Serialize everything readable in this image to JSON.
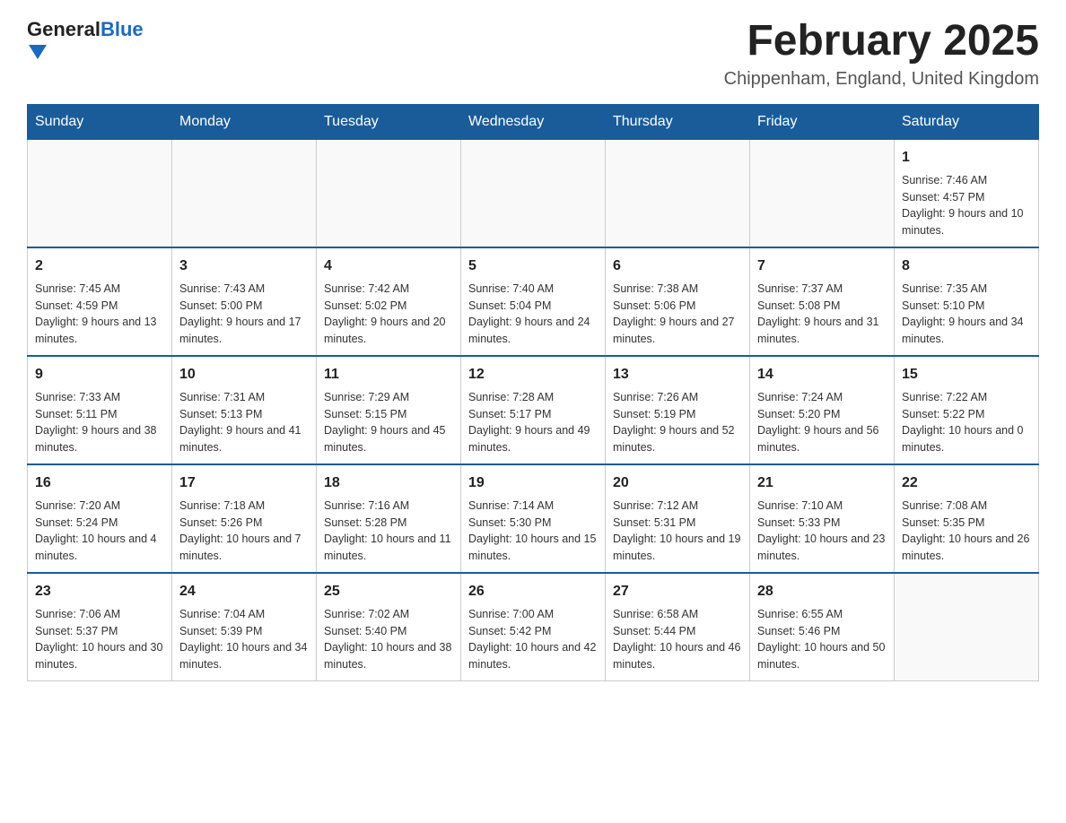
{
  "header": {
    "logo_general": "General",
    "logo_blue": "Blue",
    "title": "February 2025",
    "location": "Chippenham, England, United Kingdom"
  },
  "days_of_week": [
    "Sunday",
    "Monday",
    "Tuesday",
    "Wednesday",
    "Thursday",
    "Friday",
    "Saturday"
  ],
  "weeks": [
    [
      {
        "day": "",
        "info": ""
      },
      {
        "day": "",
        "info": ""
      },
      {
        "day": "",
        "info": ""
      },
      {
        "day": "",
        "info": ""
      },
      {
        "day": "",
        "info": ""
      },
      {
        "day": "",
        "info": ""
      },
      {
        "day": "1",
        "info": "Sunrise: 7:46 AM\nSunset: 4:57 PM\nDaylight: 9 hours and 10 minutes."
      }
    ],
    [
      {
        "day": "2",
        "info": "Sunrise: 7:45 AM\nSunset: 4:59 PM\nDaylight: 9 hours and 13 minutes."
      },
      {
        "day": "3",
        "info": "Sunrise: 7:43 AM\nSunset: 5:00 PM\nDaylight: 9 hours and 17 minutes."
      },
      {
        "day": "4",
        "info": "Sunrise: 7:42 AM\nSunset: 5:02 PM\nDaylight: 9 hours and 20 minutes."
      },
      {
        "day": "5",
        "info": "Sunrise: 7:40 AM\nSunset: 5:04 PM\nDaylight: 9 hours and 24 minutes."
      },
      {
        "day": "6",
        "info": "Sunrise: 7:38 AM\nSunset: 5:06 PM\nDaylight: 9 hours and 27 minutes."
      },
      {
        "day": "7",
        "info": "Sunrise: 7:37 AM\nSunset: 5:08 PM\nDaylight: 9 hours and 31 minutes."
      },
      {
        "day": "8",
        "info": "Sunrise: 7:35 AM\nSunset: 5:10 PM\nDaylight: 9 hours and 34 minutes."
      }
    ],
    [
      {
        "day": "9",
        "info": "Sunrise: 7:33 AM\nSunset: 5:11 PM\nDaylight: 9 hours and 38 minutes."
      },
      {
        "day": "10",
        "info": "Sunrise: 7:31 AM\nSunset: 5:13 PM\nDaylight: 9 hours and 41 minutes."
      },
      {
        "day": "11",
        "info": "Sunrise: 7:29 AM\nSunset: 5:15 PM\nDaylight: 9 hours and 45 minutes."
      },
      {
        "day": "12",
        "info": "Sunrise: 7:28 AM\nSunset: 5:17 PM\nDaylight: 9 hours and 49 minutes."
      },
      {
        "day": "13",
        "info": "Sunrise: 7:26 AM\nSunset: 5:19 PM\nDaylight: 9 hours and 52 minutes."
      },
      {
        "day": "14",
        "info": "Sunrise: 7:24 AM\nSunset: 5:20 PM\nDaylight: 9 hours and 56 minutes."
      },
      {
        "day": "15",
        "info": "Sunrise: 7:22 AM\nSunset: 5:22 PM\nDaylight: 10 hours and 0 minutes."
      }
    ],
    [
      {
        "day": "16",
        "info": "Sunrise: 7:20 AM\nSunset: 5:24 PM\nDaylight: 10 hours and 4 minutes."
      },
      {
        "day": "17",
        "info": "Sunrise: 7:18 AM\nSunset: 5:26 PM\nDaylight: 10 hours and 7 minutes."
      },
      {
        "day": "18",
        "info": "Sunrise: 7:16 AM\nSunset: 5:28 PM\nDaylight: 10 hours and 11 minutes."
      },
      {
        "day": "19",
        "info": "Sunrise: 7:14 AM\nSunset: 5:30 PM\nDaylight: 10 hours and 15 minutes."
      },
      {
        "day": "20",
        "info": "Sunrise: 7:12 AM\nSunset: 5:31 PM\nDaylight: 10 hours and 19 minutes."
      },
      {
        "day": "21",
        "info": "Sunrise: 7:10 AM\nSunset: 5:33 PM\nDaylight: 10 hours and 23 minutes."
      },
      {
        "day": "22",
        "info": "Sunrise: 7:08 AM\nSunset: 5:35 PM\nDaylight: 10 hours and 26 minutes."
      }
    ],
    [
      {
        "day": "23",
        "info": "Sunrise: 7:06 AM\nSunset: 5:37 PM\nDaylight: 10 hours and 30 minutes."
      },
      {
        "day": "24",
        "info": "Sunrise: 7:04 AM\nSunset: 5:39 PM\nDaylight: 10 hours and 34 minutes."
      },
      {
        "day": "25",
        "info": "Sunrise: 7:02 AM\nSunset: 5:40 PM\nDaylight: 10 hours and 38 minutes."
      },
      {
        "day": "26",
        "info": "Sunrise: 7:00 AM\nSunset: 5:42 PM\nDaylight: 10 hours and 42 minutes."
      },
      {
        "day": "27",
        "info": "Sunrise: 6:58 AM\nSunset: 5:44 PM\nDaylight: 10 hours and 46 minutes."
      },
      {
        "day": "28",
        "info": "Sunrise: 6:55 AM\nSunset: 5:46 PM\nDaylight: 10 hours and 50 minutes."
      },
      {
        "day": "",
        "info": ""
      }
    ]
  ]
}
